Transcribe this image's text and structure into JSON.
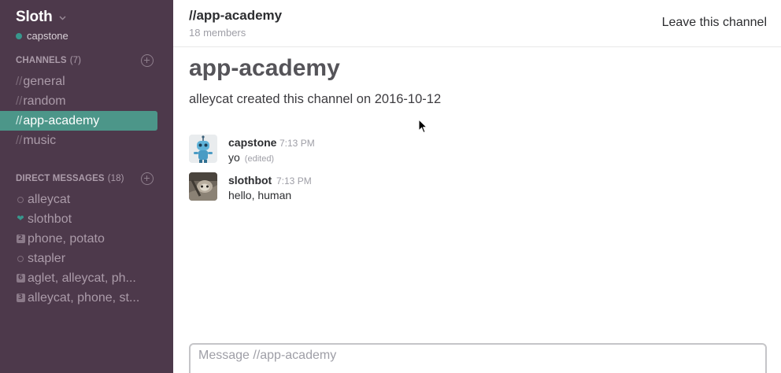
{
  "team": {
    "name": "Sloth",
    "current_user": "capstone"
  },
  "sidebar": {
    "channels_label": "CHANNELS",
    "channels_count": "(7)",
    "channels": [
      {
        "prefix": "//",
        "name": "general"
      },
      {
        "prefix": "//",
        "name": "random"
      },
      {
        "prefix": "//",
        "name": "app-academy"
      },
      {
        "prefix": "//",
        "name": "music"
      }
    ],
    "dm_label": "DIRECT MESSAGES",
    "dm_count": "(18)",
    "direct_messages": [
      {
        "icon": "presence-away-icon",
        "badge": "",
        "name": "alleycat"
      },
      {
        "icon": "heart-icon",
        "badge": "",
        "name": "slothbot"
      },
      {
        "icon": "group-count-icon",
        "badge": "2",
        "name": "phone, potato"
      },
      {
        "icon": "presence-away-icon",
        "badge": "",
        "name": "stapler"
      },
      {
        "icon": "group-count-icon",
        "badge": "6",
        "name": "aglet, alleycat, ph..."
      },
      {
        "icon": "group-count-icon",
        "badge": "3",
        "name": "alleycat, phone, st..."
      }
    ]
  },
  "header": {
    "channel_title": "//app-academy",
    "member_count": "18 members",
    "leave_label": "Leave this channel"
  },
  "intro": {
    "channel_name": "app-academy",
    "created_text": "alleycat created this channel on 2016-10-12"
  },
  "messages": [
    {
      "author": "capstone",
      "time": "7:13 PM",
      "text": "yo",
      "edited": "(edited)",
      "avatar": "robot-avatar-icon"
    },
    {
      "author": "slothbot",
      "time": "7:13 PM",
      "text": "hello, human",
      "edited": "",
      "avatar": "sloth-avatar-icon"
    }
  ],
  "composer": {
    "placeholder": "Message //app-academy"
  },
  "colors": {
    "sidebar_bg": "#4d394b",
    "active_item": "#4c9689",
    "presence_online": "#38978d"
  }
}
